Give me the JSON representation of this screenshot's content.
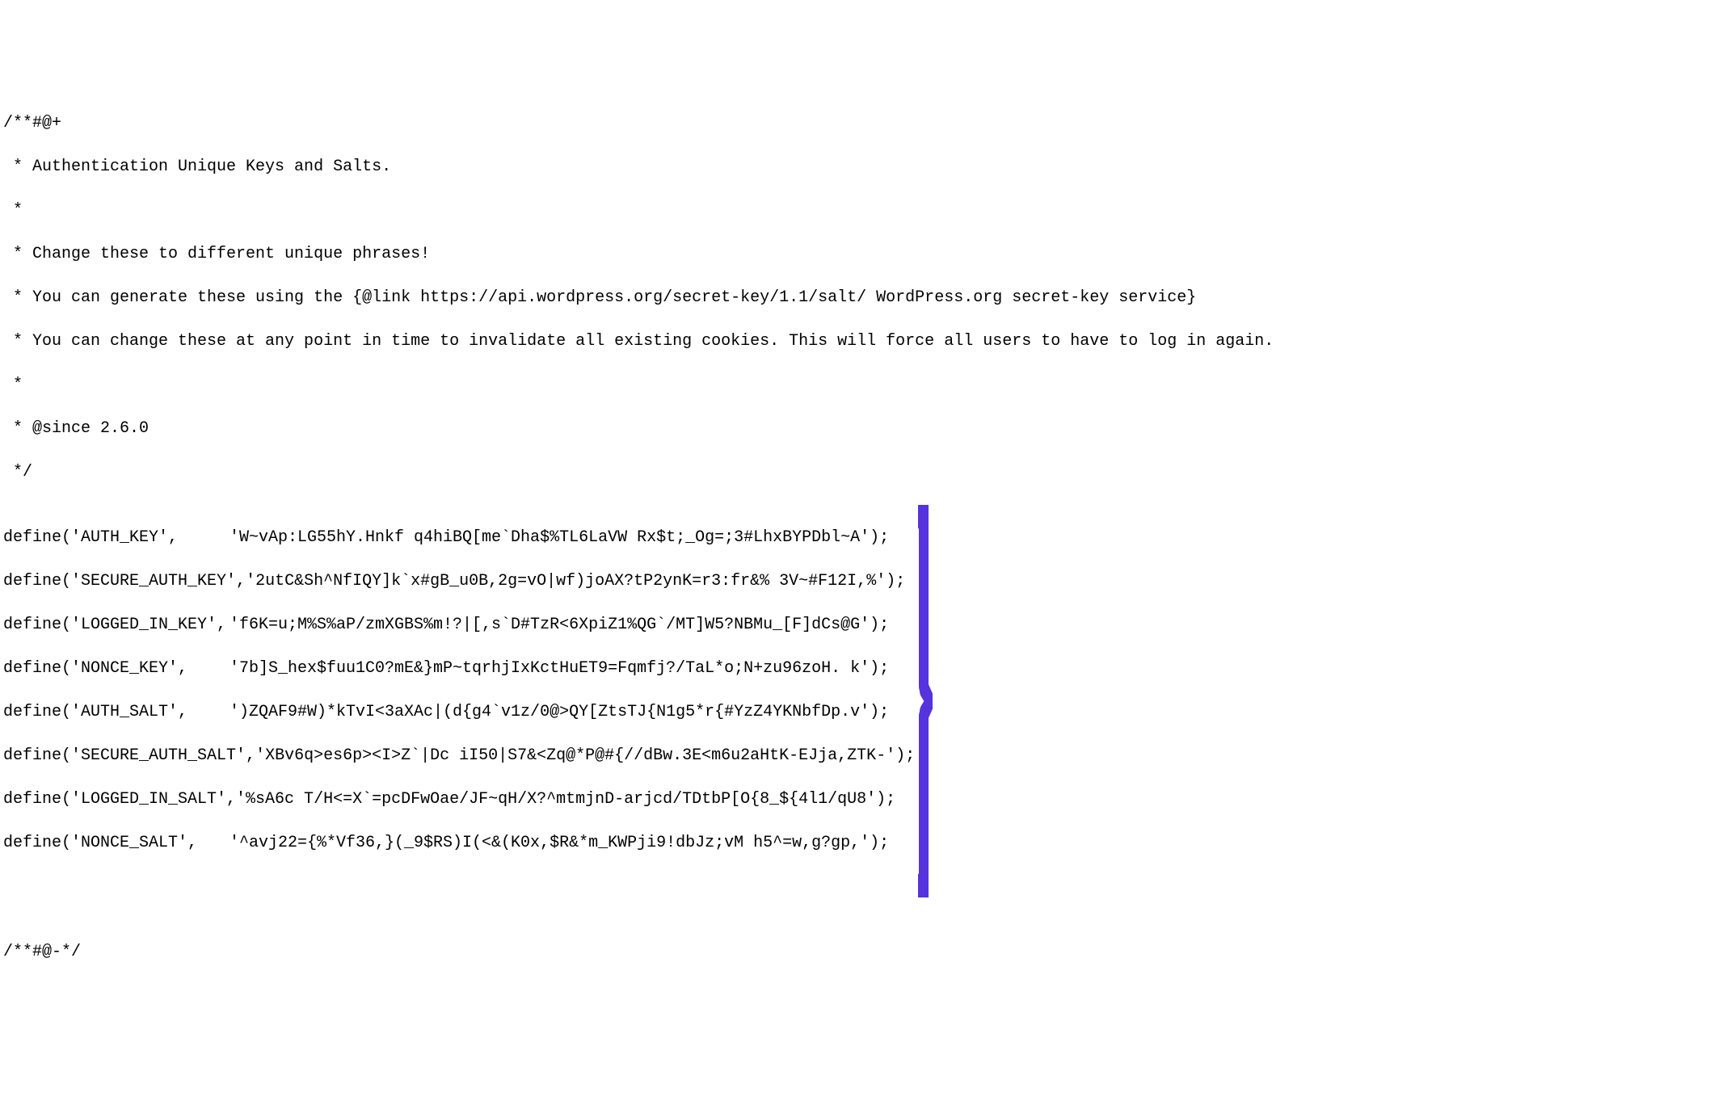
{
  "docblock": {
    "open": "/**#@+",
    "line1": " * Authentication Unique Keys and Salts.",
    "line2": " *",
    "line3": " * Change these to different unique phrases!",
    "line4": " * You can generate these using the {@link https://api.wordpress.org/secret-key/1.1/salt/ WordPress.org secret-key service}",
    "line5": " * You can change these at any point in time to invalidate all existing cookies. This will force all users to have to log in again.",
    "line6": " *",
    "line7": " * @since 2.6.0",
    "close": " */"
  },
  "defines": {
    "auth_key": {
      "key": "define('AUTH_KEY',",
      "val": "'W~vAp:LG55hY.Hnkf q4hiBQ[me`Dha$%TL6LaVW Rx$t;_Og=;3#LhxBYPDbl~A');"
    },
    "secure_auth_key": {
      "key": "define('SECURE_AUTH_KEY',",
      "val": "'2utC&Sh^NfIQY]k`x#gB_u0B,2g=vO|wf)joAX?tP2ynK=r3:fr&% 3V~#F12I,%');"
    },
    "logged_in_key": {
      "key": "define('LOGGED_IN_KEY',",
      "val": "'f6K=u;M%S%aP/zmXGBS%m!?|[,s`D#TzR<6XpiZ1%QG`/MT]W5?NBMu_[F]dCs@G');"
    },
    "nonce_key": {
      "key": "define('NONCE_KEY',",
      "val": "'7b]S_hex$fuu1C0?mE&}mP~tqrhjIxKctHuET9=Fqmfj?/TaL*o;N+zu96zoH. k');"
    },
    "auth_salt": {
      "key": "define('AUTH_SALT',",
      "val": "')ZQAF9#W)*kTvI<3aXAc|(d{g4`v1z/0@>QY[ZtsTJ{N1g5*r{#YzZ4YKNbfDp.v');"
    },
    "secure_auth_salt": {
      "key": "define('SECURE_AUTH_SALT',",
      "val": "'XBv6q>es6p><I>Z`|Dc iI50|S7&<Zq@*P@#{//dBw.3E<m6u2aHtK-EJja,ZTK-');"
    },
    "logged_in_salt": {
      "key": "define('LOGGED_IN_SALT',",
      "val": "'%sA6c T/H<=X`=pcDFwOae/JF~qH/X?^mtmjnD-arjcd/TDtbP[O{8_${4l1/qU8');"
    },
    "nonce_salt": {
      "key": "define('NONCE_SALT',",
      "val": "'^avj22={%*Vf36,}(_9$RS)I(<&(K0x,$R&*m_KWPji9!dbJz;vM h5^=w,g?gp,');"
    }
  },
  "footer": "/**#@-*/"
}
